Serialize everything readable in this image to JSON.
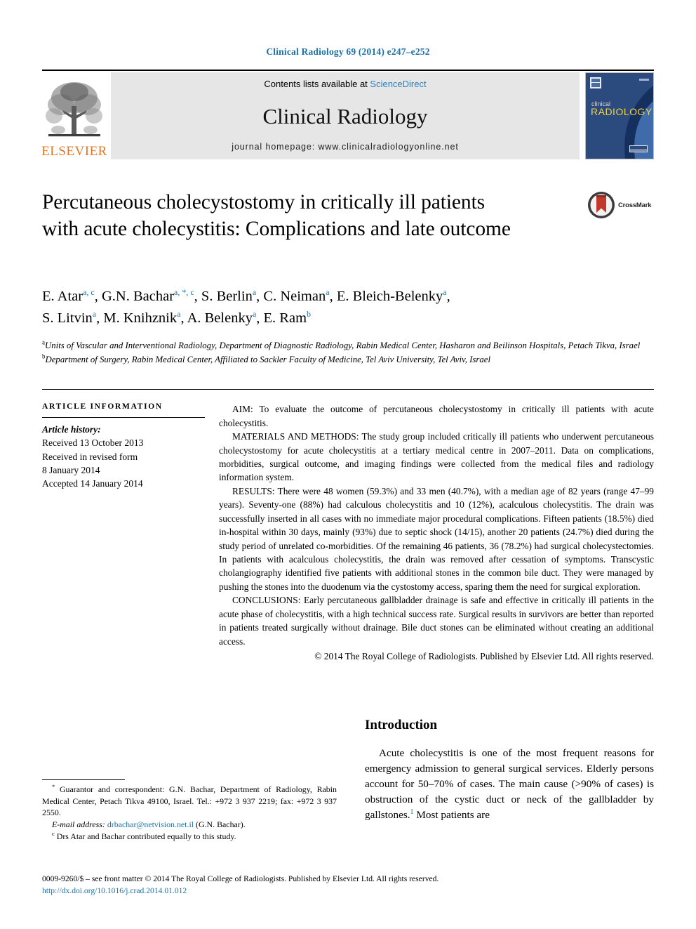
{
  "running_head": "Clinical Radiology 69 (2014) e247–e252",
  "banner": {
    "publisher_name": "ELSEVIER",
    "publisher_logo_icon": "elsevier-tree-icon",
    "contents_prefix": "Contents lists available at ",
    "contents_link": "ScienceDirect",
    "journal_name": "Clinical Radiology",
    "homepage": "journal homepage: www.clinicalradiologyonline.net",
    "cover": {
      "line1": "clinical",
      "line2": "RADIOLOGY",
      "badge": "rcr"
    }
  },
  "article": {
    "title": "Percutaneous cholecystostomy in critically ill patients with acute cholecystitis: Complications and late outcome",
    "crossmark_label": "CrossMark",
    "authors_line1": [
      {
        "name": "E. Atar",
        "sup": "a, c",
        "sep": ", "
      },
      {
        "name": "G.N. Bachar",
        "sup": "a, *, c",
        "sep": ", "
      },
      {
        "name": "S. Berlin",
        "sup": "a",
        "sep": ", "
      },
      {
        "name": "C. Neiman",
        "sup": "a",
        "sep": ", "
      },
      {
        "name": "E. Bleich-Belenky",
        "sup": "a",
        "sep": ","
      }
    ],
    "authors_line2": [
      {
        "name": "S. Litvin",
        "sup": "a",
        "sep": ", "
      },
      {
        "name": "M. Knihznik",
        "sup": "a",
        "sep": ", "
      },
      {
        "name": "A. Belenky",
        "sup": "a",
        "sep": ", "
      },
      {
        "name": "E. Ram",
        "sup": "b",
        "sep": ""
      }
    ],
    "affiliations": [
      {
        "sup": "a",
        "text": "Units of Vascular and Interventional Radiology, Department of Diagnostic Radiology, Rabin Medical Center, Hasharon and Beilinson Hospitals, Petach Tikva, Israel"
      },
      {
        "sup": "b",
        "text": "Department of Surgery, Rabin Medical Center, Affiliated to Sackler Faculty of Medicine, Tel Aviv University, Tel Aviv, Israel"
      }
    ]
  },
  "article_information": {
    "heading": "ARTICLE INFORMATION",
    "history_label": "Article history:",
    "history": [
      "Received 13 October 2013",
      "Received in revised form",
      "8 January 2014",
      "Accepted 14 January 2014"
    ]
  },
  "abstract": {
    "aim_label": "AIM:",
    "aim_text": " To evaluate the outcome of percutaneous cholecystostomy in critically ill patients with acute cholecystitis.",
    "methods_label": "MATERIALS AND METHODS:",
    "methods_text": " The study group included critically ill patients who underwent percutaneous cholecystostomy for acute cholecystitis at a tertiary medical centre in 2007–2011. Data on complications, morbidities, surgical outcome, and imaging findings were collected from the medical files and radiology information system.",
    "results_label": "RESULTS:",
    "results_text": " There were 48 women (59.3%) and 33 men (40.7%), with a median age of 82 years (range 47–99 years). Seventy-one (88%) had calculous cholecystitis and 10 (12%), acalculous cholecystitis. The drain was successfully inserted in all cases with no immediate major procedural complications. Fifteen patients (18.5%) died in-hospital within 30 days, mainly (93%) due to septic shock (14/15), another 20 patients (24.7%) died during the study period of unrelated co-morbidities. Of the remaining 46 patients, 36 (78.2%) had surgical cholecystectomies. In patients with acalculous cholecystitis, the drain was removed after cessation of symptoms. Transcystic cholangiography identified five patients with additional stones in the common bile duct. They were managed by pushing the stones into the duodenum via the cystostomy access, sparing them the need for surgical exploration.",
    "conclusions_label": "CONCLUSIONS:",
    "conclusions_text": " Early percutaneous gallbladder drainage is safe and effective in critically ill patients in the acute phase of cholecystitis, with a high technical success rate. Surgical results in survivors are better than reported in patients treated surgically without drainage. Bile duct stones can be eliminated without creating an additional access.",
    "copyright": "© 2014 The Royal College of Radiologists. Published by Elsevier Ltd. All rights reserved."
  },
  "introduction": {
    "heading": "Introduction",
    "paragraph_part1": "Acute cholecystitis is one of the most frequent reasons for emergency admission to general surgical services. Elderly persons account for 50–70% of cases. The main cause (>90% of cases) is obstruction of the cystic duct or neck of the gallbladder by gallstones.",
    "reference_marker": "1",
    "paragraph_part2": " Most patients are"
  },
  "footnotes": {
    "correspondence_marker": "*",
    "correspondence": " Guarantor and correspondent: G.N. Bachar, Department of Radiology, Rabin Medical Center, Petach Tikva 49100, Israel. Tel.: +972 3 937 2219; fax: +972 3 937 2550.",
    "email_label": "E-mail address:",
    "email": "drbachar@netvision.net.il",
    "email_owner": " (G.N. Bachar).",
    "equal_contribution_marker": "c",
    "equal_contribution": " Drs Atar and Bachar contributed equally to this study."
  },
  "bottom": {
    "issn_line": "0009-9260/$ – see front matter © 2014 The Royal College of Radiologists. Published by Elsevier Ltd. All rights reserved.",
    "doi": "http://dx.doi.org/10.1016/j.crad.2014.01.012"
  },
  "colors": {
    "link_blue": "#1a72a8",
    "sciencedirect_blue": "#2f7fbf",
    "elsevier_orange": "#e87722",
    "banner_grey": "#e6e6e6",
    "cover_navy": "#2b4a7d"
  }
}
